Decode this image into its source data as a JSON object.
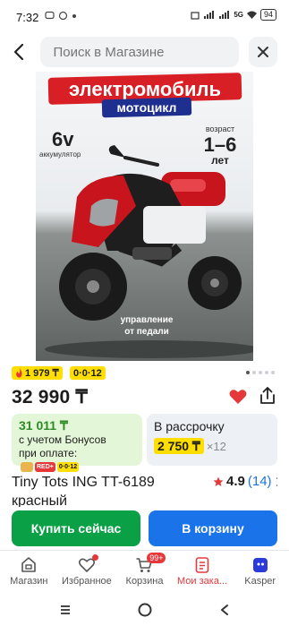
{
  "status_bar": {
    "time": "7:32",
    "network": "5G",
    "battery": "94"
  },
  "search": {
    "placeholder": "Поиск в Магазине"
  },
  "product_image": {
    "headline": "электромобиль",
    "subheadline": "мотоцикл",
    "battery_voltage": "6v",
    "battery_label": "аккумулятор",
    "age_label": "возраст",
    "age_value": "1–6",
    "age_unit": "лет",
    "control_note_line1": "управление",
    "control_note_line2": "от педали"
  },
  "gallery": {
    "total": 5,
    "active_index": 0
  },
  "badges": {
    "bonus": "1 979 ₸",
    "installment": "0·0·12"
  },
  "price": "32 990 ₸",
  "bonus_offer": {
    "price": "31 011 ₸",
    "note_line1": "с учетом Бонусов",
    "note_line2": "при оплате:",
    "pay_icon_2": "RED+",
    "pay_icon_3": "0·0·12"
  },
  "installment_offer": {
    "title": "В рассрочку",
    "amount": "2 750 ₸",
    "multiplier": "×12"
  },
  "product": {
    "title": "Tiny Tots ING TT-6189 красный",
    "rating": "4.9",
    "reviews": "(14)"
  },
  "actions": {
    "buy_now": "Купить сейчас",
    "add_to_cart": "В корзину"
  },
  "bottom_nav": {
    "items": [
      {
        "label": "Магазин"
      },
      {
        "label": "Избранное"
      },
      {
        "label": "Корзина",
        "badge": "99+"
      },
      {
        "label": "Мои зака..."
      },
      {
        "label": "Kasper"
      }
    ]
  },
  "colors": {
    "accent_red": "#e5383b",
    "buy_green": "#0aa046",
    "cart_blue": "#1a73e8",
    "highlight_yellow": "#ffde00"
  }
}
